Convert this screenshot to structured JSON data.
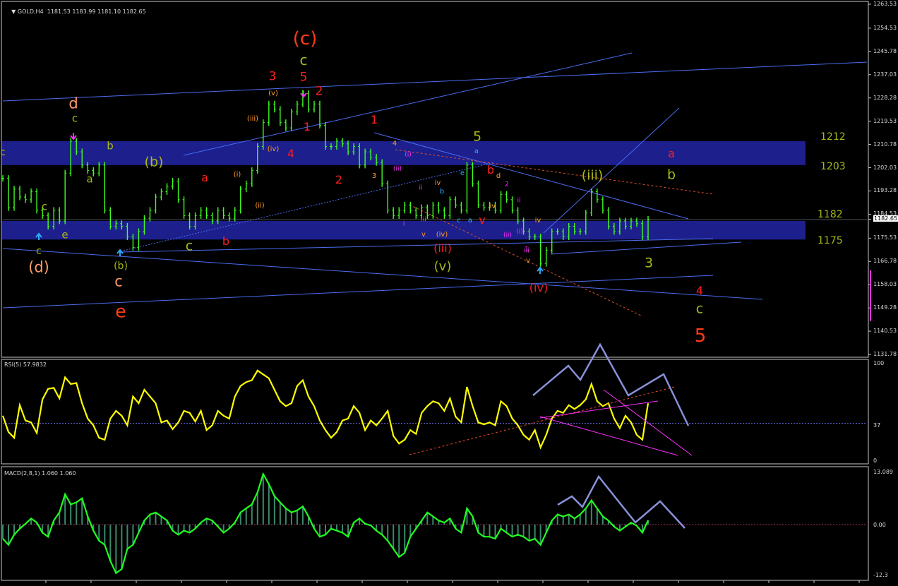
{
  "chart_data": [
    {
      "type": "line",
      "title": "GOLD,H4",
      "header": {
        "symbol": "GOLD,H4",
        "ohlc": "1181.53 1183.99 1181.10 1182.65"
      },
      "series": [
        {
          "name": "GOLD,H4",
          "style": "ohlc-bars",
          "color": "#40ff20",
          "close": [
            1198,
            1187,
            1194,
            1191,
            1190,
            1193,
            1186,
            1184,
            1180,
            1186,
            1182,
            1200,
            1212,
            1208,
            1203,
            1201,
            1200,
            1203,
            1186,
            1180,
            1181,
            1180,
            1176,
            1172,
            1178,
            1183,
            1186,
            1191,
            1193,
            1195,
            1197,
            1190,
            1184,
            1180,
            1184,
            1186,
            1184,
            1182,
            1186,
            1184,
            1183,
            1186,
            1194,
            1196,
            1201,
            1210,
            1219,
            1226,
            1224,
            1219,
            1217,
            1223,
            1226,
            1230,
            1224,
            1226,
            1218,
            1210,
            1210,
            1212,
            1211,
            1208,
            1210,
            1203,
            1208,
            1206,
            1204,
            1196,
            1186,
            1184,
            1186,
            1188,
            1186,
            1184,
            1187,
            1184,
            1188,
            1186,
            1184,
            1190,
            1188,
            1186,
            1203,
            1196,
            1188,
            1187,
            1188,
            1186,
            1192,
            1190,
            1186,
            1182,
            1178,
            1176,
            1176,
            1166,
            1171,
            1178,
            1178,
            1176,
            1180,
            1178,
            1178,
            1185,
            1193,
            1190,
            1186,
            1180,
            1178,
            1182,
            1180,
            1182,
            1181,
            1176,
            1182.65
          ]
        }
      ],
      "price_scale": [
        "1263.53",
        "1254.53",
        "1245.78",
        "1237.03",
        "1228.28",
        "1219.53",
        "1210.78",
        "1202.03",
        "1193.28",
        "1184.53",
        "1182.65",
        "1175.53",
        "1166.78",
        "1158.03",
        "1149.28",
        "1140.53",
        "1131.78"
      ],
      "ylim": [
        1131.78,
        1263.53
      ],
      "levels": [
        {
          "label": "1212",
          "zone": [
            1203,
            1212
          ]
        },
        {
          "label": "1203"
        },
        {
          "label": "1182",
          "zone": [
            1175,
            1182
          ]
        },
        {
          "label": "1175"
        }
      ],
      "annotations": [
        "(c)",
        "c",
        "3",
        "5",
        "2",
        "1",
        "4",
        "(v)",
        "(iii)",
        "(iv)",
        "(i)",
        "(ii)",
        "d",
        "c",
        "b",
        "a",
        "c",
        "e",
        "(b)",
        "c",
        "a",
        "b",
        "1",
        "2",
        "4",
        "3",
        "(ii)",
        "(i)",
        "i",
        "ii",
        "iii",
        "iv",
        "v",
        "(iv)",
        "(iii)",
        "(v)",
        "5",
        "a",
        "b",
        "e",
        "c",
        "a",
        "b",
        "d",
        "2",
        "(ii)",
        "ii",
        "iii",
        "iv",
        "v",
        "(i)",
        "1",
        "iv",
        "v",
        "(iv)",
        "(iii)",
        "3",
        "a",
        "b",
        "4",
        "c",
        "5",
        "c",
        "(d)"
      ]
    },
    {
      "type": "line",
      "title": "RSI(5) 57.9832",
      "header": "RSI(5) 57.9832",
      "series": [
        {
          "name": "RSI(5)",
          "color": "#ffff00",
          "values": [
            45,
            28,
            22,
            56,
            40,
            38,
            27,
            62,
            73,
            74,
            63,
            85,
            78,
            79,
            58,
            42,
            35,
            22,
            20,
            42,
            50,
            45,
            35,
            65,
            58,
            72,
            65,
            58,
            38,
            40,
            31,
            38,
            50,
            48,
            39,
            50,
            30,
            35,
            50,
            45,
            42,
            65,
            76,
            80,
            82,
            92,
            88,
            84,
            72,
            60,
            55,
            58,
            76,
            82,
            65,
            55,
            40,
            30,
            22,
            28,
            40,
            42,
            55,
            48,
            30,
            40,
            35,
            42,
            50,
            24,
            16,
            20,
            30,
            26,
            48,
            55,
            60,
            58,
            50,
            63,
            44,
            38,
            75,
            55,
            38,
            36,
            38,
            35,
            60,
            55,
            42,
            35,
            25,
            20,
            30,
            12,
            25,
            42,
            50,
            48,
            56,
            52,
            56,
            62,
            78,
            60,
            55,
            58,
            42,
            32,
            45,
            38,
            25,
            20,
            58
          ]
        },
        {
          "name": "level 37",
          "values": [
            37
          ]
        }
      ],
      "ylim": [
        0,
        100
      ],
      "scale_labels": [
        "100",
        "37",
        "0"
      ]
    },
    {
      "type": "bar",
      "title": "MACD(2,8,1) 1.060 1.060",
      "header": "MACD(2,8,1) 1.060 1.060",
      "series": [
        {
          "name": "MACD",
          "color": "#20ff20",
          "values": [
            -3.5,
            -5,
            -2.5,
            -1,
            0.2,
            1.5,
            0.5,
            -2,
            -3,
            1,
            3,
            7.5,
            5,
            5.5,
            6.5,
            2,
            -1.5,
            -4,
            -5,
            -9,
            -12,
            -11,
            -6,
            -5,
            -2,
            1,
            2.5,
            3,
            2,
            1,
            -1.5,
            -2.5,
            -1.5,
            -2,
            -1,
            0.5,
            1.5,
            1,
            -0.5,
            -2,
            -1,
            0.5,
            3,
            4,
            5,
            8,
            12.5,
            10,
            7,
            5.5,
            4,
            3,
            3.5,
            4.5,
            2,
            -1,
            -3,
            -2.5,
            -1,
            -1.5,
            -2,
            -3,
            0.5,
            1.5,
            0.2,
            -0.2,
            -1.5,
            -2.5,
            -4,
            -6,
            -8,
            -7,
            -3,
            -1,
            1,
            3,
            2,
            1,
            0.5,
            1.5,
            -1,
            -2,
            4,
            2,
            -2,
            -3,
            -3,
            -3.5,
            -1,
            -2,
            -3,
            -2.5,
            -3,
            -4,
            -3.5,
            -5,
            -2,
            1,
            2.5,
            2,
            2.5,
            1.5,
            2.5,
            4,
            6,
            4,
            2,
            1,
            -0.5,
            -1.5,
            -0.5,
            0.5,
            -0.3,
            -2,
            1.06
          ]
        },
        {
          "name": "zero",
          "values": [
            0
          ]
        }
      ],
      "ylim": [
        -12.3,
        13.089
      ],
      "scale_labels": [
        "13.089",
        "0.00",
        "-12.3"
      ]
    }
  ]
}
